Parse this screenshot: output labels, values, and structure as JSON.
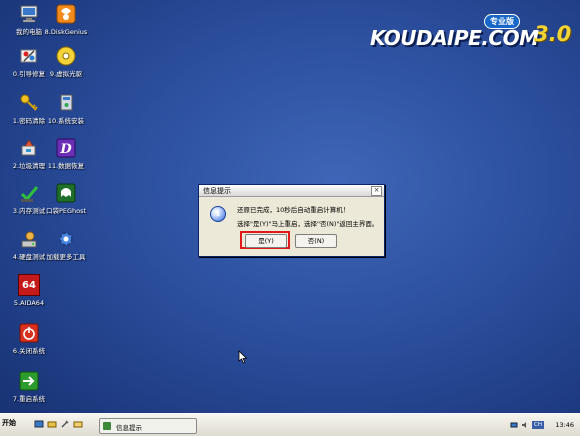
{
  "brand": {
    "name": "KOUDAIPE.COM",
    "badge": "专业版",
    "version": "3.0"
  },
  "desktop_icons": [
    {
      "label": "我的电脑",
      "icon": "computer-icon"
    },
    {
      "label": "8.DiskGenius",
      "icon": "diskgenius-icon"
    },
    {
      "label": "0.引导修复",
      "icon": "boot-repair-icon"
    },
    {
      "label": "9.虚拟光驱",
      "icon": "virtual-drive-icon"
    },
    {
      "label": "1.密码清除",
      "icon": "key-icon"
    },
    {
      "label": "10.系统安装",
      "icon": "system-install-icon"
    },
    {
      "label": "2.垃圾清理",
      "icon": "cleanup-icon"
    },
    {
      "label": "11.数据恢复",
      "icon": "data-recovery-icon"
    },
    {
      "label": "3.内存测试",
      "icon": "memory-test-icon"
    },
    {
      "label": "口袋PEGhost",
      "icon": "ghost-icon"
    },
    {
      "label": "4.硬盘测试",
      "icon": "disk-test-icon"
    },
    {
      "label": "加载更多工具",
      "icon": "more-tools-icon"
    },
    {
      "label": "5.AIDA64",
      "icon": "aida64-icon",
      "glyph_text": "64"
    },
    {
      "label": "6.关闭系统",
      "icon": "shutdown-icon"
    },
    {
      "label": "7.重启系统",
      "icon": "restart-icon"
    }
  ],
  "dialog": {
    "title": "信息提示",
    "close": "×",
    "message_line1": "还原已完成，10秒后自动重启计算机！",
    "message_line2": "选择\"是(Y)\"马上重启，选择\"否(N)\"返回主界面。",
    "yes_label": "是(Y)",
    "no_label": "否(N)"
  },
  "taskbar": {
    "start_label": "开始",
    "task_label": "信息提示",
    "clock": "13:46",
    "tray_lang": "CH"
  },
  "colors": {
    "desktop": "#2c4f9e",
    "highlight": "#e01a1a",
    "brand_version": "#f2d533"
  }
}
